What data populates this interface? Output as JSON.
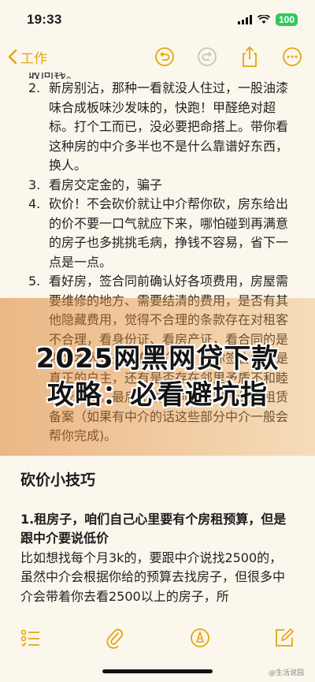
{
  "status_bar": {
    "time": "19:33",
    "battery": "100"
  },
  "toolbar": {
    "back_label": "工作"
  },
  "note": {
    "top_fragment": "收回钱。",
    "items": [
      {
        "num": "2.",
        "text": "新房别沾，那种一看就没人住过，一股油漆味合成板味沙发味的，快跑！甲醛绝对超标。打个工而已，没必要把命搭上。带你看这种房的中介多半也不是什么靠谱好东西，换人。"
      },
      {
        "num": "3.",
        "text": " 看房交定金的，骗子"
      },
      {
        "num": "4.",
        "text": " 砍价！不会砍价就让中介帮你砍，房东给出的价不要一口气就应下来，哪怕碰到再满意的房子也多挑挑毛病，挣钱不容易，省下一点是一点。"
      },
      {
        "num": "5.",
        "text": " 看好房，签合同前确认好各项费用，房屋需要维修的地方、需要结清的费用，是否有其他隐藏费用，觉得不合理的条款存在对租客不合理，看身份证、看房产证，看合同的是否为本人，是否有中介费，是你签合同的是真正的户主，还有是否存在邻里矛盾不和睦这些问题。最后完成合同到派出所做好租赁备案（如果有中介的话这些部分中介一般会帮你完成)。"
      }
    ],
    "section_title": "砍价小技巧",
    "sub_heading": "1.租房子，咱们自己心里要有个房租预算，但是跟中介要说低价",
    "paragraph": "比如想找每个月3k的，要跟中介说找2500的，虽然中介会根据你给的预算去找房子，但很多中介会带着你去看2500以上的房子，所"
  },
  "overlay": {
    "line1": "2025网黑网贷下款",
    "line2": "攻略：必看避坑指"
  },
  "credit": "@生活说园",
  "colors": {
    "accent": "#e3a512",
    "background": "#fbf7ec",
    "battery": "#34c759"
  },
  "icons": [
    "chevron-left-icon",
    "undo-icon",
    "redo-icon",
    "share-icon",
    "more-icon",
    "checklist-icon",
    "paperclip-icon",
    "markup-icon",
    "compose-icon"
  ]
}
